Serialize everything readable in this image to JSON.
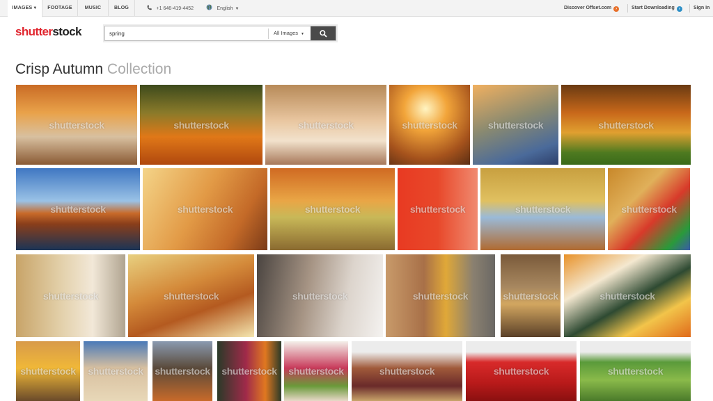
{
  "nav": {
    "tabs": [
      {
        "label": "IMAGES",
        "active": true
      },
      {
        "label": "FOOTAGE"
      },
      {
        "label": "MUSIC"
      },
      {
        "label": "BLOG"
      }
    ],
    "phone": "+1 646-419-4452",
    "language": "English",
    "links": {
      "offset": "Discover Offset.com",
      "download": "Start Downloading",
      "signin": "Sign In"
    }
  },
  "brand": {
    "logo_part1": "shutter",
    "logo_part2": "stock"
  },
  "search": {
    "value": "spring",
    "filter": "All Images"
  },
  "collection": {
    "title_main": "Crisp Autumn",
    "title_sub": "Collection"
  },
  "watermark": "shutterstock",
  "icons": {
    "tab_caret": "caret-down-icon",
    "phone": "phone-icon",
    "globe": "globe-icon",
    "language_caret": "caret-down-icon",
    "offset_arrow": "arrow-right-circle-icon",
    "download_arrow": "arrow-right-circle-icon",
    "filter_caret": "caret-down-icon",
    "search": "magnifier-icon"
  },
  "colors": {
    "brand_red": "#e0252e",
    "search_button": "#4a4a4a",
    "accent_orange": "#e8702a",
    "accent_blue": "#2c8fc7"
  }
}
